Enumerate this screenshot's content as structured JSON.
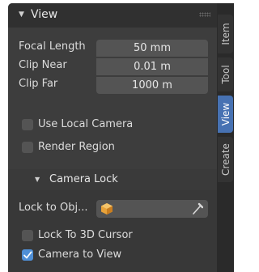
{
  "panel": {
    "title": "View",
    "rows": [
      {
        "label": "Focal Length",
        "value": "50 mm"
      },
      {
        "label": "Clip Near",
        "value": "0.01 m"
      },
      {
        "label": "Clip Far",
        "value": "1000 m"
      }
    ],
    "checkboxes": [
      {
        "label": "Use Local Camera",
        "checked": false
      },
      {
        "label": "Render Region",
        "checked": false
      }
    ],
    "camera_lock": {
      "title": "Camera Lock",
      "lock_object_label": "Lock to Obj...",
      "lock_object_icon": "cube-icon",
      "eyedropper_icon": "eyedropper-icon",
      "checkboxes": [
        {
          "label": "Lock To 3D Cursor",
          "checked": false
        },
        {
          "label": "Camera to View",
          "checked": true
        }
      ]
    }
  },
  "sidebar_tabs": [
    {
      "label": "Item",
      "active": false
    },
    {
      "label": "Tool",
      "active": false
    },
    {
      "label": "View",
      "active": true
    },
    {
      "label": "Create",
      "active": false
    }
  ],
  "colors": {
    "accent": "#4772b3",
    "checkbox_on": "#4f8fd6",
    "panel_bg": "#3d3d3d",
    "field_bg": "#545454",
    "object_icon": "#e8a33a"
  }
}
